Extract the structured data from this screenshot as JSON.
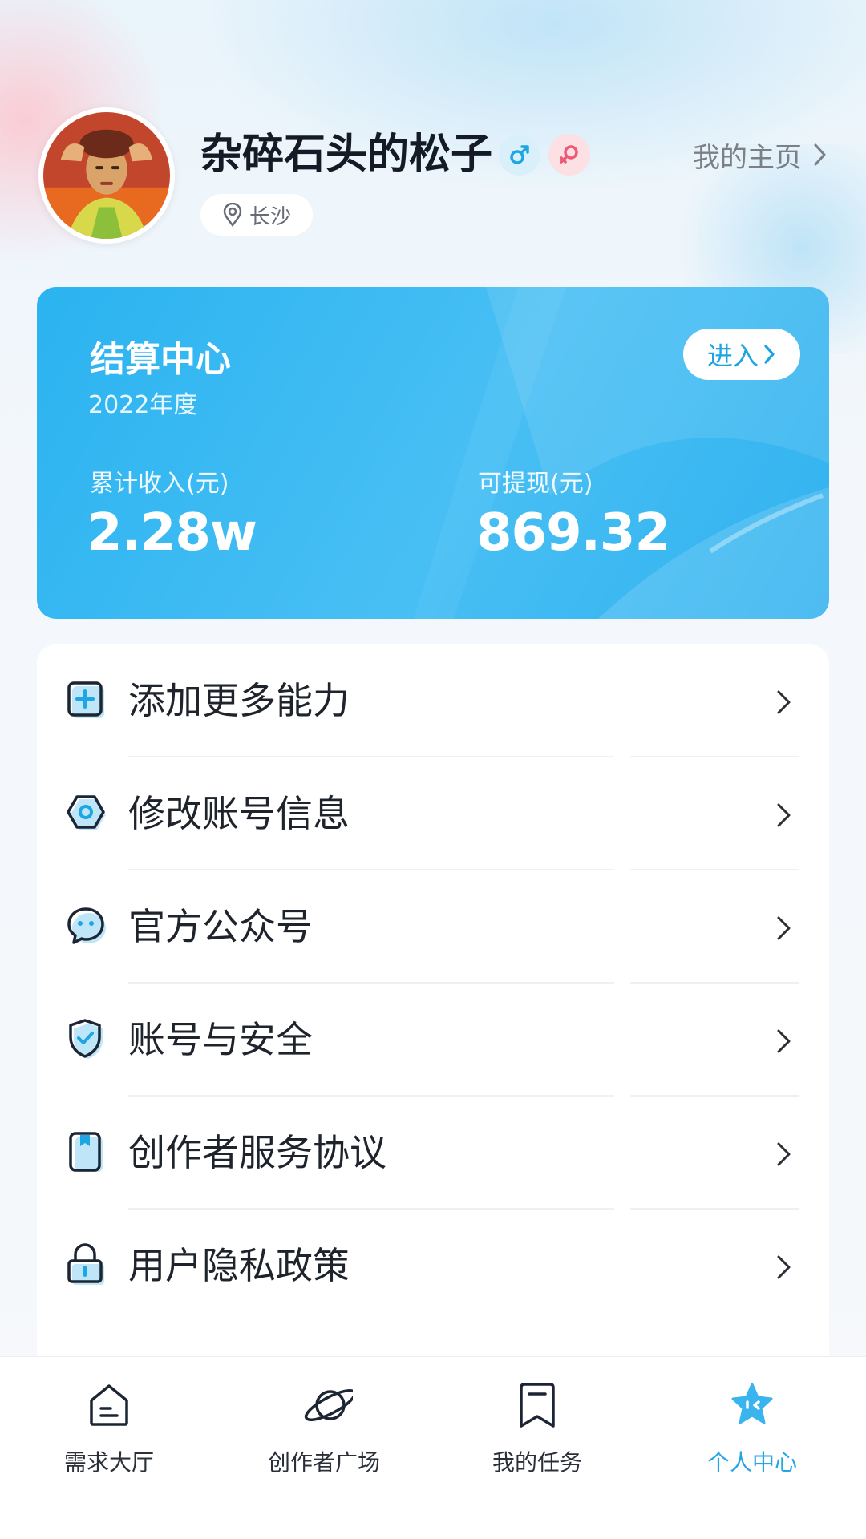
{
  "profile": {
    "username": "杂碎石头的松子",
    "location": "长沙",
    "homepage_label": "我的主页",
    "badges": [
      "male-symbol-icon",
      "female-symbol-icon"
    ]
  },
  "settlement": {
    "title": "结算中心",
    "subtitle": "2022年度",
    "enter_label": "进入",
    "total_income_label": "累计收入(元)",
    "total_income_value": "2.28w",
    "withdrawable_label": "可提现(元)",
    "withdrawable_value": "869.32"
  },
  "menu": {
    "items": [
      {
        "label": "添加更多能力",
        "icon": "plus-square-icon"
      },
      {
        "label": "修改账号信息",
        "icon": "hexagon-gear-icon"
      },
      {
        "label": "官方公众号",
        "icon": "chat-bubble-icon"
      },
      {
        "label": "账号与安全",
        "icon": "shield-check-icon"
      },
      {
        "label": "创作者服务协议",
        "icon": "bookmark-doc-icon"
      },
      {
        "label": "用户隐私政策",
        "icon": "lock-icon"
      }
    ]
  },
  "tabbar": {
    "items": [
      {
        "label": "需求大厅",
        "icon": "house-icon"
      },
      {
        "label": "创作者广场",
        "icon": "planet-icon"
      },
      {
        "label": "我的任务",
        "icon": "bookmark-icon"
      },
      {
        "label": "个人中心",
        "icon": "star-icon",
        "active": true
      }
    ]
  },
  "colors": {
    "accent": "#24a6e6",
    "card": "#2bb3f0",
    "text": "#1e232c"
  }
}
